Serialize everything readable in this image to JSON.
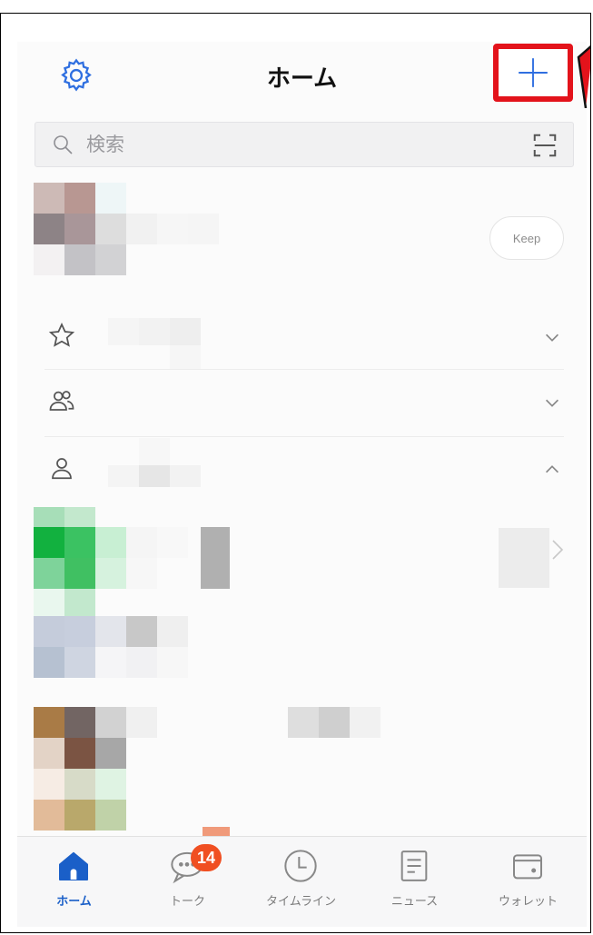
{
  "header": {
    "title": "ホーム"
  },
  "search": {
    "placeholder": "検索"
  },
  "profile": {
    "keep_label": "Keep"
  },
  "tabs": [
    {
      "label": "ホーム",
      "icon": "home-icon",
      "active": true
    },
    {
      "label": "トーク",
      "icon": "chat-icon",
      "badge": "14"
    },
    {
      "label": "タイムライン",
      "icon": "clock-icon"
    },
    {
      "label": "ニュース",
      "icon": "news-icon"
    },
    {
      "label": "ウォレット",
      "icon": "wallet-icon"
    }
  ],
  "colors": {
    "accent_blue": "#1a5fc8",
    "highlight_red": "#e3131b",
    "badge_orange": "#f04f22"
  }
}
